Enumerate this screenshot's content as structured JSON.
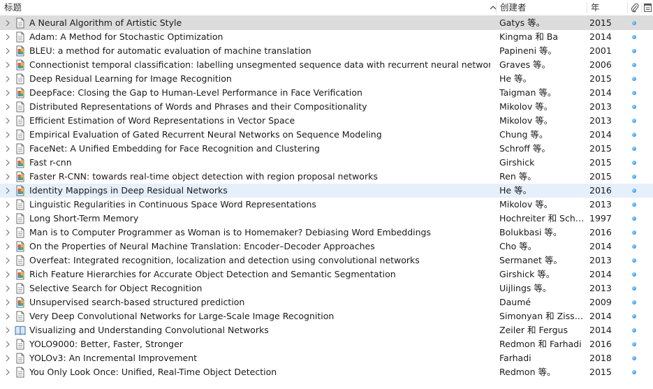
{
  "columns": {
    "title": "标题",
    "creator": "创建者",
    "year": "年"
  },
  "icons": {
    "attachment_header": "paperclip-icon",
    "notes_header": "notes-icon",
    "row_types": [
      "document-icon",
      "journal-article-icon",
      "book-icon"
    ]
  },
  "selected_row_index": 0,
  "highlighted_row_index": 12,
  "items": [
    {
      "title": "A Neural Algorithm of Artistic Style",
      "creator": "Gatys 等。",
      "year": "2015",
      "type": "document"
    },
    {
      "title": "Adam: A Method for Stochastic Optimization",
      "creator": "Kingma 和 Ba",
      "year": "2014",
      "type": "document"
    },
    {
      "title": "BLEU: a method for automatic evaluation of machine translation",
      "creator": "Papineni 等。",
      "year": "2001",
      "type": "article"
    },
    {
      "title": "Connectionist temporal classification: labelling unsegmented sequence data with recurrent neural networks",
      "creator": "Graves 等。",
      "year": "2006",
      "type": "article"
    },
    {
      "title": "Deep Residual Learning for Image Recognition",
      "creator": "He 等。",
      "year": "2015",
      "type": "document"
    },
    {
      "title": "DeepFace: Closing the Gap to Human-Level Performance in Face Verification",
      "creator": "Taigman 等。",
      "year": "2014",
      "type": "article"
    },
    {
      "title": "Distributed Representations of Words and Phrases and their Compositionality",
      "creator": "Mikolov 等。",
      "year": "2013",
      "type": "document"
    },
    {
      "title": "Efficient Estimation of Word Representations in Vector Space",
      "creator": "Mikolov 等。",
      "year": "2013",
      "type": "document"
    },
    {
      "title": "Empirical Evaluation of Gated Recurrent Neural Networks on Sequence Modeling",
      "creator": "Chung 等。",
      "year": "2014",
      "type": "document"
    },
    {
      "title": "FaceNet: A Unified Embedding for Face Recognition and Clustering",
      "creator": "Schroff 等。",
      "year": "2015",
      "type": "document"
    },
    {
      "title": "Fast r-cnn",
      "creator": "Girshick",
      "year": "2015",
      "type": "article"
    },
    {
      "title": "Faster R-CNN: towards real-time object detection with region proposal networks",
      "creator": "Ren 等。",
      "year": "2015",
      "type": "article"
    },
    {
      "title": "Identity Mappings in Deep Residual Networks",
      "creator": "He 等。",
      "year": "2016",
      "type": "article"
    },
    {
      "title": "Linguistic Regularities in Continuous Space Word Representations",
      "creator": "Mikolov 等。",
      "year": "2013",
      "type": "document"
    },
    {
      "title": "Long Short-Term Memory",
      "creator": "Hochreiter 和 Schmi...",
      "year": "1997",
      "type": "document"
    },
    {
      "title": "Man is to Computer Programmer as Woman is to Homemaker? Debiasing Word Embeddings",
      "creator": "Bolukbasi 等。",
      "year": "2016",
      "type": "document"
    },
    {
      "title": "On the Properties of Neural Machine Translation: Encoder–Decoder Approaches",
      "creator": "Cho 等。",
      "year": "2014",
      "type": "article"
    },
    {
      "title": "Overfeat: Integrated recognition, localization and detection using convolutional networks",
      "creator": "Sermanet 等。",
      "year": "2013",
      "type": "document"
    },
    {
      "title": "Rich Feature Hierarchies for Accurate Object Detection and Semantic Segmentation",
      "creator": "Girshick 等。",
      "year": "2014",
      "type": "article"
    },
    {
      "title": "Selective Search for Object Recognition",
      "creator": "Uijlings 等。",
      "year": "2013",
      "type": "document"
    },
    {
      "title": "Unsupervised search-based structured prediction",
      "creator": "Daumé",
      "year": "2009",
      "type": "article"
    },
    {
      "title": "Very Deep Convolutional Networks for Large-Scale Image Recognition",
      "creator": "Simonyan 和 Zisser...",
      "year": "2014",
      "type": "document"
    },
    {
      "title": "Visualizing and Understanding Convolutional Networks",
      "creator": "Zeiler 和 Fergus",
      "year": "2014",
      "type": "book"
    },
    {
      "title": "YOLO9000: Better, Faster, Stronger",
      "creator": "Redmon 和 Farhadi",
      "year": "2016",
      "type": "document"
    },
    {
      "title": "YOLOv3: An Incremental Improvement",
      "creator": "Farhadi",
      "year": "2018",
      "type": "document"
    },
    {
      "title": "You Only Look Once: Unified, Real-Time Object Detection",
      "creator": "Redmon 等。",
      "year": "2015",
      "type": "document"
    }
  ]
}
